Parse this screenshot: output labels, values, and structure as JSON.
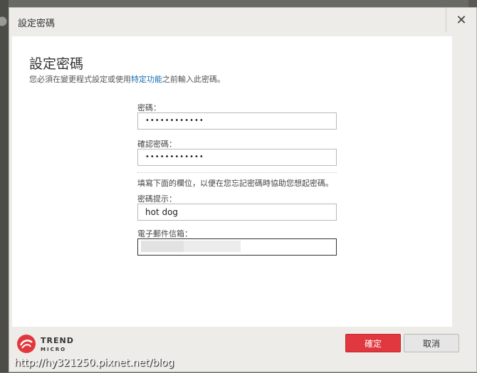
{
  "window": {
    "title": "設定密碼",
    "close_symbol": "✕"
  },
  "main": {
    "heading": "設定密碼",
    "subtitle_before": "您必須在變更程式設定或使用",
    "subtitle_link": "特定功能",
    "subtitle_after": "之前輸入此密碼。"
  },
  "form": {
    "password_label": "密碼：",
    "password_value": "••••••••••••",
    "confirm_label": "確認密碼：",
    "confirm_value": "••••••••••••",
    "note": "填寫下面的欄位，以便在您忘記密碼時協助您想起密碼。",
    "hint_label": "密碼提示：",
    "hint_value": "hot dog",
    "email_label": "電子郵件信箱："
  },
  "footer": {
    "logo_line1": "TREND",
    "logo_line2": "MICRO",
    "ok_label": "確定",
    "cancel_label": "取消",
    "brand_color": "#e0383e"
  },
  "watermark": "http://hy321250.pixnet.net/blog"
}
